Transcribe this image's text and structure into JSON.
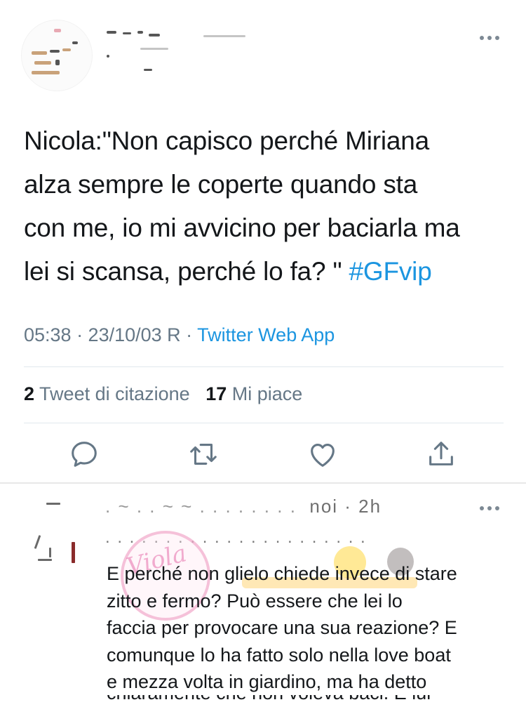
{
  "tweet": {
    "text_lines": [
      "Nicola:\"Non capisco perché Miriana",
      "alza sempre le coperte quando sta",
      "con me, io mi avvicino per baciarla ma",
      "lei si scansa, perché lo fa? \" "
    ],
    "hashtag": "#GFvip",
    "time": "05:38 · 23/10/03 R · ",
    "source": "Twitter Web App",
    "quote_count": "2",
    "quote_label": " Tweet di citazione",
    "like_count": "17",
    "like_label": " Mi piace",
    "actions": [
      "reply-icon",
      "retweet-icon",
      "like-icon",
      "share-icon"
    ]
  },
  "reply": {
    "time": "noi · 2h",
    "lines": [
      "E perché non glielo chiede invece di stare",
      "zitto e fermo? Può essere che lei lo",
      "faccia per provocare una sua reazione? E",
      "comunque lo ha fatto solo nella love boat",
      "e mezza volta in giardino, ma ha detto",
      "chiaramente che non voleva baci. È lui"
    ]
  },
  "colors": {
    "link": "#1b95e0",
    "secondary": "#657786",
    "text": "#14171a",
    "divider": "#e1e8ed"
  }
}
